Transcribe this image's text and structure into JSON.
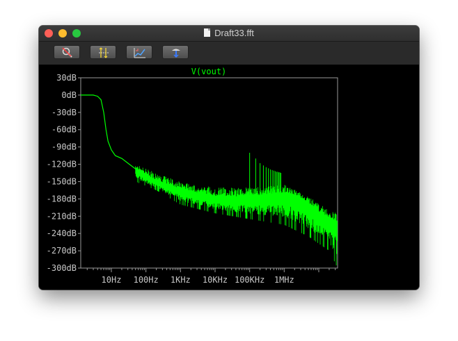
{
  "window": {
    "title": "Draft33.fft"
  },
  "toolbar": {
    "buttons": [
      {
        "icon": "zoom-cancel-icon"
      },
      {
        "icon": "autoscale-icon"
      },
      {
        "icon": "zoom-fit-icon"
      },
      {
        "icon": "probe-icon"
      }
    ]
  },
  "colors": {
    "trace": "#00ff00",
    "axes": "#9a9a9a",
    "tick_text": "#c8c8c8",
    "background": "#000000"
  },
  "chart_data": {
    "type": "line",
    "title": "V(vout)",
    "xscale": "log",
    "xlim": [
      1.3,
      35000000
    ],
    "ylim": [
      -300,
      30
    ],
    "yticks": [
      "30dB",
      "0dB",
      "-30dB",
      "-60dB",
      "-90dB",
      "-120dB",
      "-150dB",
      "-180dB",
      "-210dB",
      "-240dB",
      "-270dB",
      "-300dB"
    ],
    "ytick_values": [
      30,
      0,
      -30,
      -60,
      -90,
      -120,
      -150,
      -180,
      -210,
      -240,
      -270,
      -300
    ],
    "xticks": [
      "10Hz",
      "100Hz",
      "1KHz",
      "10KHz",
      "100KHz",
      "1MHz"
    ],
    "xtick_values": [
      10,
      100,
      1000,
      10000,
      100000,
      1000000
    ],
    "series": [
      {
        "name": "V(vout)",
        "color": "#00ff00",
        "points": [
          [
            1.3,
            0
          ],
          [
            3,
            0
          ],
          [
            4,
            -2
          ],
          [
            5,
            -8
          ],
          [
            6,
            -30
          ],
          [
            7,
            -60
          ],
          [
            8,
            -80
          ],
          [
            10,
            -95
          ],
          [
            13,
            -105
          ],
          [
            20,
            -110
          ],
          [
            30,
            -118
          ],
          [
            50,
            -128
          ],
          [
            100,
            -140
          ],
          [
            200,
            -150
          ],
          [
            500,
            -160
          ],
          [
            1000,
            -165
          ],
          [
            3000,
            -172
          ],
          [
            10000,
            -178
          ],
          [
            30000,
            -180
          ],
          [
            100000,
            -178
          ],
          [
            300000,
            -176
          ],
          [
            1000000,
            -172
          ],
          [
            2000000,
            -175
          ],
          [
            5000000,
            -190
          ],
          [
            10000000,
            -205
          ],
          [
            20000000,
            -215
          ],
          [
            35000000,
            -222
          ]
        ],
        "noise_band": [
          [
            50,
            -120,
            -150
          ],
          [
            200,
            -135,
            -165
          ],
          [
            1000,
            -150,
            -190
          ],
          [
            10000,
            -160,
            -205
          ],
          [
            100000,
            -160,
            -215
          ],
          [
            1000000,
            -155,
            -225
          ],
          [
            5000000,
            -175,
            -245
          ],
          [
            20000000,
            -200,
            -270
          ],
          [
            35000000,
            -205,
            -300
          ]
        ],
        "spikes": [
          [
            100000,
            -100
          ],
          [
            150000,
            -110
          ],
          [
            200000,
            -118
          ],
          [
            250000,
            -122
          ],
          [
            300000,
            -125
          ],
          [
            350000,
            -127
          ],
          [
            400000,
            -129
          ],
          [
            450000,
            -130
          ],
          [
            500000,
            -131
          ],
          [
            550000,
            -132
          ],
          [
            600000,
            -133
          ],
          [
            650000,
            -133
          ],
          [
            700000,
            -134
          ],
          [
            750000,
            -134
          ],
          [
            800000,
            -135
          ]
        ]
      }
    ]
  }
}
